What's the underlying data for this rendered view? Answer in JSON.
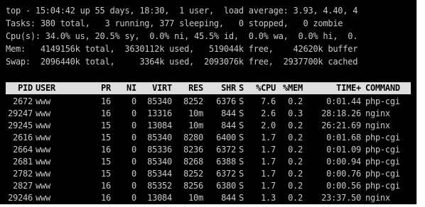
{
  "summary": {
    "line1": "top - 15:04:42 up 55 days, 18:30,  1 user,  load average: 3.93, 4.40, 4",
    "line2": "Tasks: 380 total,   3 running, 377 sleeping,   0 stopped,   0 zombie",
    "line3": "Cpu(s): 34.0% us, 20.5% sy,  0.0% ni, 45.5% id,  0.0% wa,  0.0% hi,  0.",
    "line4": "Mem:   4149156k total,  3630112k used,   519044k free,    42620k buffer",
    "line5": "Swap:  2096440k total,     3364k used,  2093076k free,  2937700k cached"
  },
  "columns": {
    "pid": "PID",
    "user": "USER",
    "pr": "PR",
    "ni": "NI",
    "virt": "VIRT",
    "res": "RES",
    "shr": "SHR",
    "s": "S",
    "cpu": "%CPU",
    "mem": "%MEM",
    "time": "TIME+",
    "command": "COMMAND"
  },
  "processes": [
    {
      "pid": "2672",
      "user": "www",
      "pr": "16",
      "ni": "0",
      "virt": "85340",
      "res": "8252",
      "shr": "6376",
      "s": "S",
      "cpu": "7.6",
      "mem": "0.2",
      "time": "0:01.44",
      "command": "php-cgi"
    },
    {
      "pid": "29247",
      "user": "www",
      "pr": "16",
      "ni": "0",
      "virt": "13316",
      "res": "10m",
      "shr": "844",
      "s": "S",
      "cpu": "2.6",
      "mem": "0.3",
      "time": "28:18.26",
      "command": "nginx"
    },
    {
      "pid": "29245",
      "user": "www",
      "pr": "15",
      "ni": "0",
      "virt": "13084",
      "res": "10m",
      "shr": "844",
      "s": "S",
      "cpu": "2.0",
      "mem": "0.2",
      "time": "26:21.69",
      "command": "nginx"
    },
    {
      "pid": "2616",
      "user": "www",
      "pr": "15",
      "ni": "0",
      "virt": "85340",
      "res": "8280",
      "shr": "6400",
      "s": "S",
      "cpu": "1.7",
      "mem": "0.2",
      "time": "0:01.68",
      "command": "php-cgi"
    },
    {
      "pid": "2664",
      "user": "www",
      "pr": "16",
      "ni": "0",
      "virt": "85336",
      "res": "8236",
      "shr": "6372",
      "s": "S",
      "cpu": "1.7",
      "mem": "0.2",
      "time": "0:01.09",
      "command": "php-cgi"
    },
    {
      "pid": "2681",
      "user": "www",
      "pr": "15",
      "ni": "0",
      "virt": "85340",
      "res": "8268",
      "shr": "6388",
      "s": "S",
      "cpu": "1.7",
      "mem": "0.2",
      "time": "0:00.94",
      "command": "php-cgi"
    },
    {
      "pid": "2782",
      "user": "www",
      "pr": "15",
      "ni": "0",
      "virt": "85344",
      "res": "8252",
      "shr": "6372",
      "s": "S",
      "cpu": "1.7",
      "mem": "0.2",
      "time": "0:00.76",
      "command": "php-cgi"
    },
    {
      "pid": "2827",
      "user": "www",
      "pr": "16",
      "ni": "0",
      "virt": "85352",
      "res": "8256",
      "shr": "6380",
      "s": "S",
      "cpu": "1.7",
      "mem": "0.2",
      "time": "0:00.56",
      "command": "php-cgi"
    },
    {
      "pid": "29246",
      "user": "www",
      "pr": "16",
      "ni": "0",
      "virt": "13084",
      "res": "10m",
      "shr": "844",
      "s": "S",
      "cpu": "1.3",
      "mem": "0.2",
      "time": "23:37.50",
      "command": "nginx"
    }
  ]
}
